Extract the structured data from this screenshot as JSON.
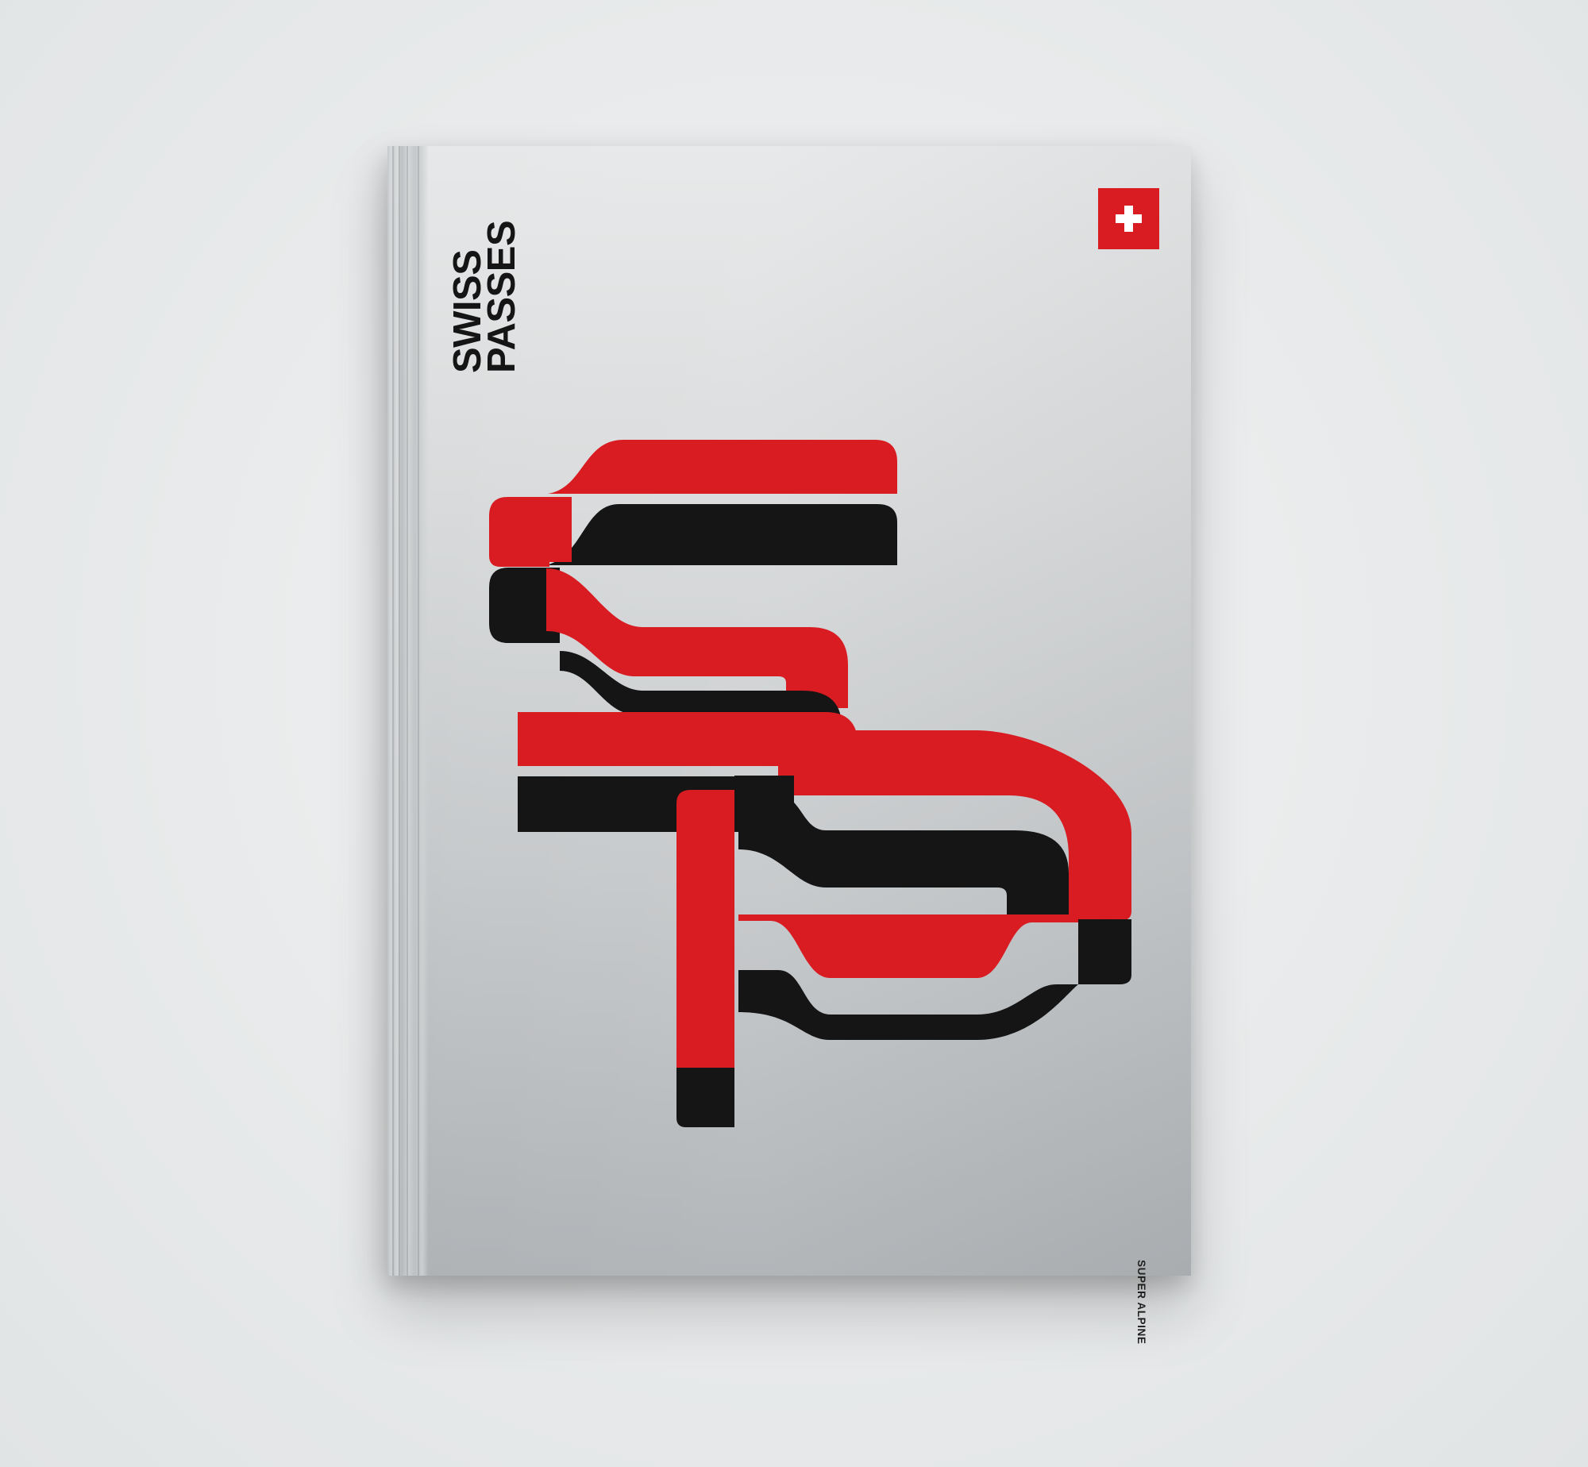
{
  "cover": {
    "title_lines": [
      "SWISS",
      "PASSES"
    ],
    "subtitle": "SUPER ALPINE"
  },
  "colors": {
    "red": "#d91b22",
    "black": "#151515",
    "silver_top": "#e6e8e9",
    "silver_bottom": "#aeb2b5",
    "background": "#e9ebec"
  },
  "icons": {
    "flag": "swiss-flag-icon"
  }
}
